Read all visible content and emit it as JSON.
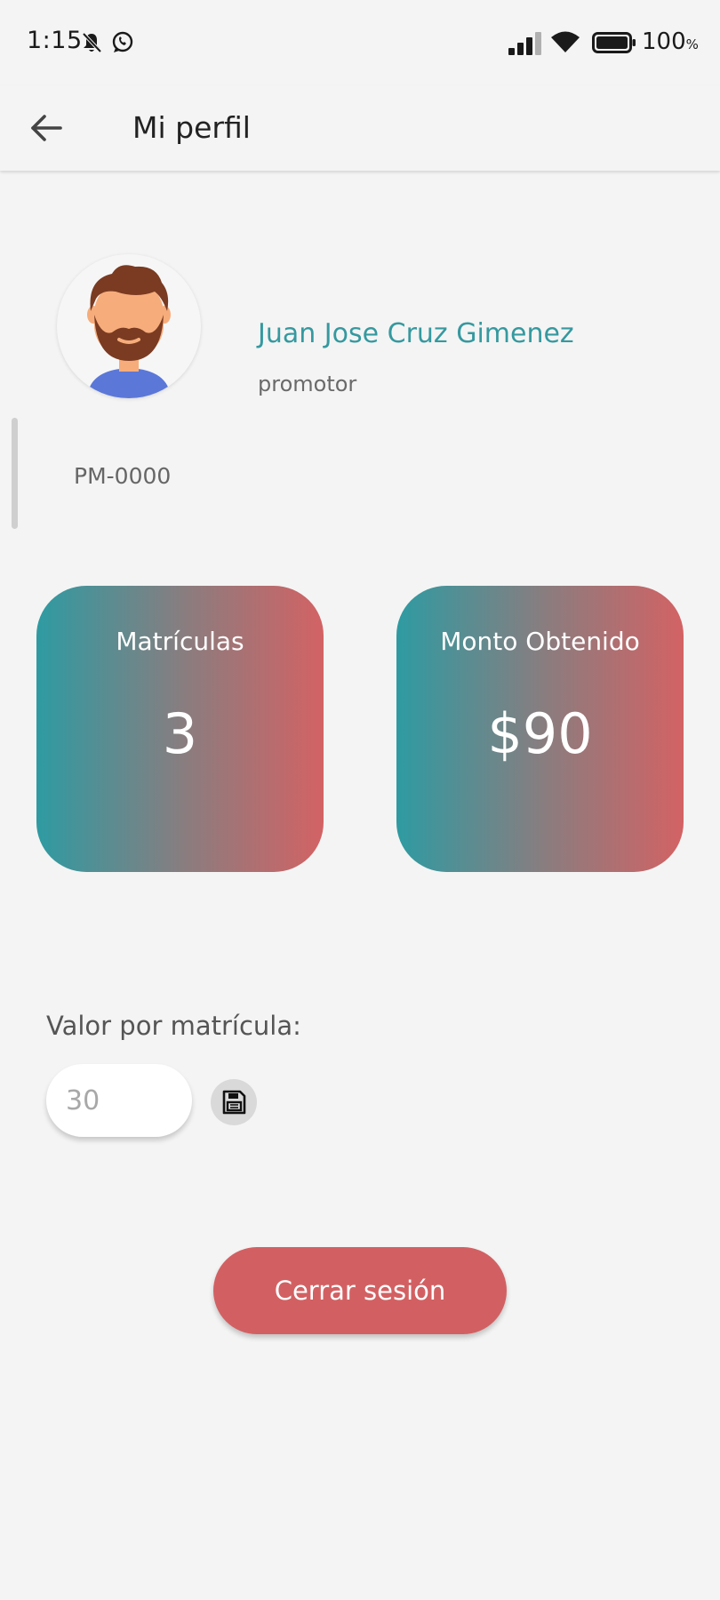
{
  "status_bar": {
    "time": "1:15",
    "battery_percent": "100",
    "battery_unit": "%",
    "icons": [
      "bell-off-icon",
      "whatsapp-icon",
      "signal-icon",
      "wifi-icon",
      "battery-icon"
    ]
  },
  "app_bar": {
    "title": "Mi perfil",
    "back_icon": "arrow-left-icon"
  },
  "profile": {
    "name": "Juan Jose Cruz Gimenez",
    "role": "promotor",
    "code": "PM-0000",
    "name_color": "#35999f"
  },
  "stats": [
    {
      "label": "Matrículas",
      "value": "3"
    },
    {
      "label": "Monto Obtenido",
      "value": "$90"
    }
  ],
  "card_gradient": [
    "#2e9ba2",
    "#d36264"
  ],
  "value_section": {
    "label": "Valor por matrícula:",
    "input_placeholder": "30",
    "input_value": "",
    "save_icon": "floppy-disk-icon"
  },
  "logout": {
    "label": "Cerrar sesión",
    "color": "#d26062"
  }
}
